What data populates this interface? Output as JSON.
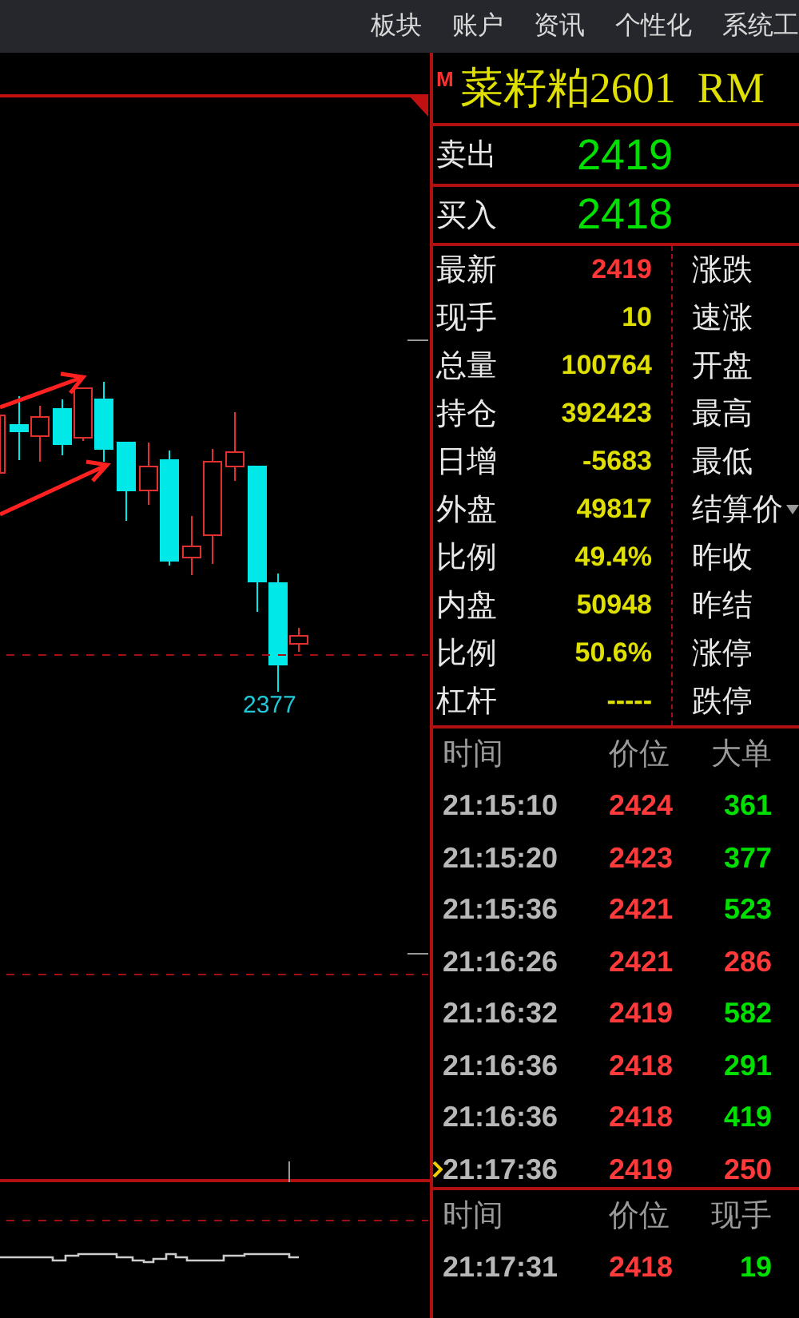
{
  "menu": [
    "板块",
    "账户",
    "资讯",
    "个性化",
    "系统工"
  ],
  "quote": {
    "badge": "M",
    "title": "菜籽粕2601  RM"
  },
  "book": [
    {
      "label": "卖出",
      "price": "2419"
    },
    {
      "label": "买入",
      "price": "2418"
    }
  ],
  "stats": [
    {
      "label": "最新",
      "value": "2419",
      "color": "#ff3636",
      "right_label": "涨跌",
      "dropdown": false
    },
    {
      "label": "现手",
      "value": "10",
      "color": "#e0e000",
      "right_label": "速涨",
      "dropdown": false
    },
    {
      "label": "总量",
      "value": "100764",
      "color": "#e0e000",
      "right_label": "开盘",
      "dropdown": false
    },
    {
      "label": "持仓",
      "value": "392423",
      "color": "#e0e000",
      "right_label": "最高",
      "dropdown": false
    },
    {
      "label": "日增",
      "value": "-5683",
      "color": "#e0e000",
      "right_label": "最低",
      "dropdown": false
    },
    {
      "label": "外盘",
      "value": "49817",
      "color": "#e0e000",
      "right_label": "结算价",
      "dropdown": true
    },
    {
      "label": "比例",
      "value": "49.4%",
      "color": "#e0e000",
      "right_label": "昨收",
      "dropdown": false
    },
    {
      "label": "内盘",
      "value": "50948",
      "color": "#e0e000",
      "right_label": "昨结",
      "dropdown": false
    },
    {
      "label": "比例",
      "value": "50.6%",
      "color": "#e0e000",
      "right_label": "涨停",
      "dropdown": false
    },
    {
      "label": "杠杆",
      "value": "-----",
      "color": "#e0e000",
      "right_label": "跌停",
      "dropdown": false
    }
  ],
  "chart": {
    "low_label": "2377"
  },
  "big_orders": {
    "columns": [
      "时间",
      "价位",
      "大单"
    ],
    "rows": [
      {
        "time": "21:15:10",
        "price": "2424",
        "size": "361",
        "color": "#00e000",
        "current": false
      },
      {
        "time": "21:15:20",
        "price": "2423",
        "size": "377",
        "color": "#00e000",
        "current": false
      },
      {
        "time": "21:15:36",
        "price": "2421",
        "size": "523",
        "color": "#00e000",
        "current": false
      },
      {
        "time": "21:16:26",
        "price": "2421",
        "size": "286",
        "color": "#ff3a3a",
        "current": false
      },
      {
        "time": "21:16:32",
        "price": "2419",
        "size": "582",
        "color": "#00e000",
        "current": false
      },
      {
        "time": "21:16:36",
        "price": "2418",
        "size": "291",
        "color": "#00e000",
        "current": false
      },
      {
        "time": "21:16:36",
        "price": "2418",
        "size": "419",
        "color": "#00e000",
        "current": false
      },
      {
        "time": "21:17:36",
        "price": "2419",
        "size": "250",
        "color": "#ff3a3a",
        "current": true
      }
    ]
  },
  "ticks": {
    "columns": [
      "时间",
      "价位",
      "现手"
    ],
    "rows": [
      {
        "time": "21:17:31",
        "price": "2418",
        "size": "19",
        "color": "#00e000",
        "current": false
      }
    ]
  }
}
